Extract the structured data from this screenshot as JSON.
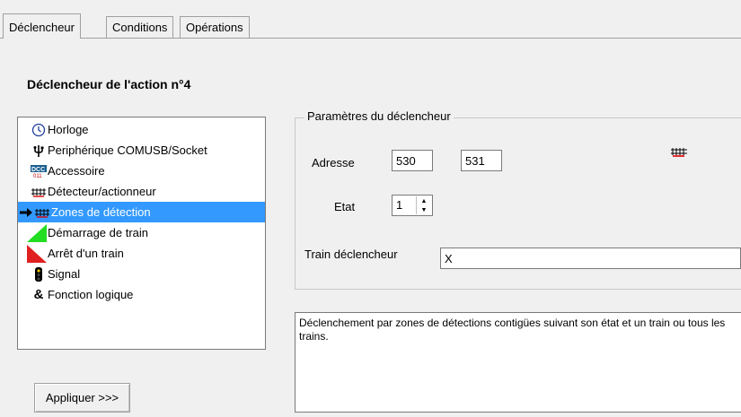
{
  "tabs": [
    {
      "label": "Déclencheur",
      "active": true
    },
    {
      "label": "Conditions",
      "active": false
    },
    {
      "label": "Opérations",
      "active": false
    }
  ],
  "title": "Déclencheur de l'action n°4",
  "trigger_list": {
    "items": [
      {
        "label": "Horloge",
        "icon": "clock-icon"
      },
      {
        "label": "Periphérique COMUSB/Socket",
        "icon": "usb-icon"
      },
      {
        "label": "Accessoire",
        "icon": "dcc-icon"
      },
      {
        "label": "Détecteur/actionneur",
        "icon": "track-sensor-icon"
      },
      {
        "label": "Zones de détection",
        "icon": "detection-zone-icon",
        "selected": true
      },
      {
        "label": "Démarrage de train",
        "icon": "train-start-icon"
      },
      {
        "label": "Arrêt d'un train",
        "icon": "train-stop-icon"
      },
      {
        "label": "Signal",
        "icon": "signal-icon"
      },
      {
        "label": "Fonction logique",
        "icon": "logic-function-icon"
      }
    ]
  },
  "apply_button": "Appliquer >>>",
  "params": {
    "legend": "Paramètres du déclencheur",
    "address_label": "Adresse",
    "address1": "530",
    "address2": "531",
    "state_label": "Etat",
    "state_value": "1",
    "train_label": "Train déclencheur",
    "train_value": "X"
  },
  "description": "Déclenchement par zones de détections contigües suivant son état et un train ou tous les trains.",
  "colors": {
    "selection": "#3399ff",
    "window_bg": "#f0f0f0"
  }
}
